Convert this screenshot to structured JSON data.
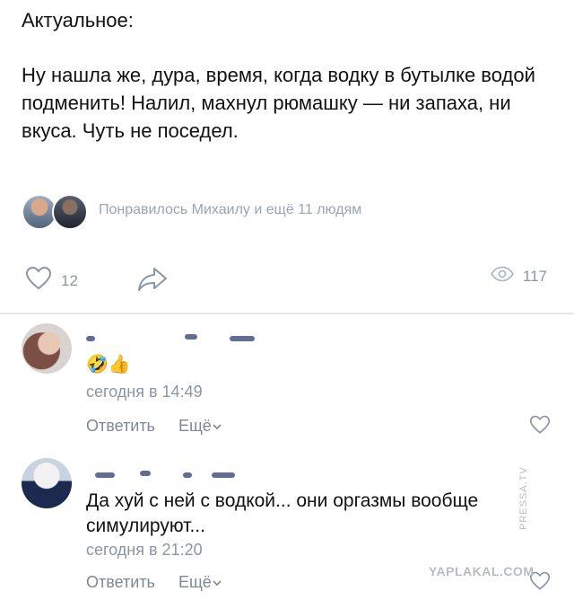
{
  "post": {
    "title": "Актуальное:",
    "text": "Ну нашла же, дура, время, когда водку в бутылке водой подменить! Налил, махнул рюмашку — ни запаха, ни вкуса. Чуть не поседел.",
    "likes_text": "Понравилось Михаилу и ещё 11 людям",
    "like_count": "12",
    "views_count": "117"
  },
  "comments": [
    {
      "emoji": "🤣👍",
      "text": "",
      "time": "сегодня в 14:49",
      "reply_label": "Ответить",
      "more_label": "Ещё"
    },
    {
      "emoji": "",
      "text": "Да хуй с ней с водкой... они оргазмы вообще симулируют...",
      "time": "сегодня в 21:20",
      "reply_label": "Ответить",
      "more_label": "Ещё"
    }
  ],
  "watermarks": {
    "site": "YAPLAKAL.COM",
    "side": "PRESSA.TV"
  },
  "colors": {
    "accent_gray": "#8a96a5",
    "text": "#111111",
    "divider": "#e7e8ec"
  },
  "icons": [
    "heart-icon",
    "share-arrow-icon",
    "eye-icon",
    "chevron-down-icon"
  ]
}
